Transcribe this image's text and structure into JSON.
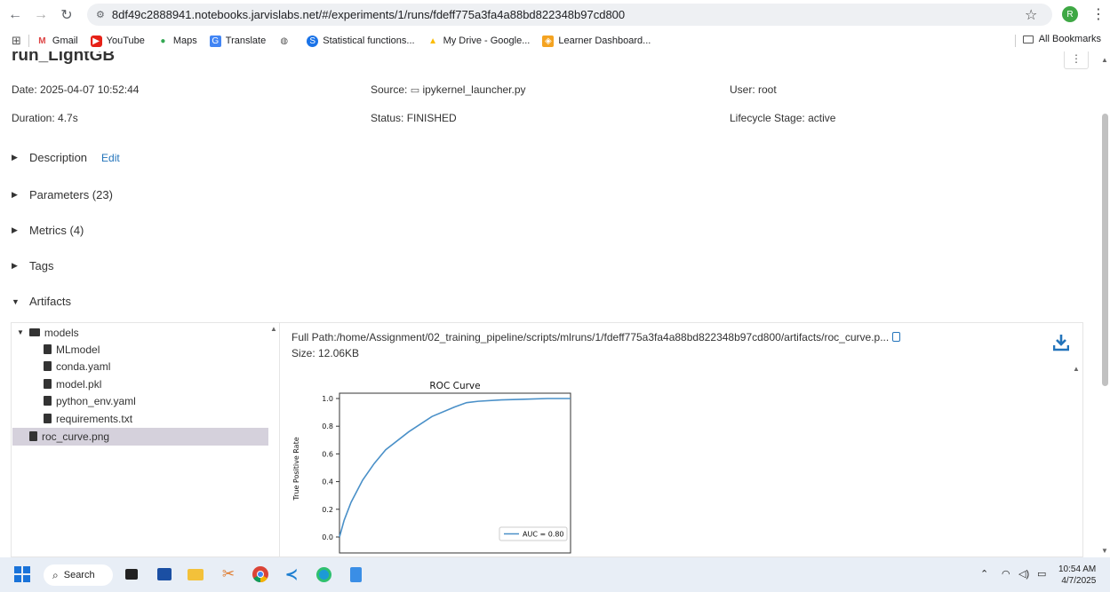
{
  "browser": {
    "url": "8df49c2888941.notebooks.jarvislabs.net/#/experiments/1/runs/fdeff775a3fa4a88bd822348b97cd800",
    "profile_initial": "R",
    "bookmarks": [
      "Gmail",
      "YouTube",
      "Maps",
      "Translate",
      "",
      "Statistical functions...",
      "My Drive - Google...",
      "Learner Dashboard..."
    ],
    "all_bookmarks": "All Bookmarks"
  },
  "run": {
    "title": "run_LightGB",
    "date_label": "Date:",
    "date_value": "2025-04-07 10:52:44",
    "source_label": "Source:",
    "source_value": "ipykernel_launcher.py",
    "user_label": "User:",
    "user_value": "root",
    "duration_label": "Duration:",
    "duration_value": "4.7s",
    "status_label": "Status:",
    "status_value": "FINISHED",
    "lifecycle_label": "Lifecycle Stage:",
    "lifecycle_value": "active"
  },
  "sections": {
    "description": "Description",
    "edit": "Edit",
    "parameters": "Parameters (23)",
    "metrics": "Metrics (4)",
    "tags": "Tags",
    "artifacts": "Artifacts"
  },
  "tree": {
    "models": "models",
    "mlmodel": "MLmodel",
    "conda": "conda.yaml",
    "model_pkl": "model.pkl",
    "python_env": "python_env.yaml",
    "requirements": "requirements.txt",
    "roc": "roc_curve.png"
  },
  "preview": {
    "full_path": "Full Path:/home/Assignment/02_training_pipeline/scripts/mlruns/1/fdeff775a3fa4a88bd822348b97cd800/artifacts/roc_curve.p...",
    "size": "Size: 12.06KB"
  },
  "chart_data": {
    "type": "line",
    "title": "ROC Curve",
    "ylabel": "True Positive Rate",
    "ylim": [
      0,
      1.0
    ],
    "xlim": [
      0,
      1.0
    ],
    "y_ticks": [
      "0.0",
      "0.2",
      "0.4",
      "0.6",
      "0.8",
      "1.0"
    ],
    "series": [
      {
        "name": "AUC = 0.80",
        "color": "#4a90c8",
        "x": [
          0.0,
          0.02,
          0.05,
          0.1,
          0.15,
          0.2,
          0.3,
          0.4,
          0.5,
          0.55,
          0.6,
          0.7,
          0.8,
          0.9,
          1.0
        ],
        "y": [
          0.0,
          0.12,
          0.25,
          0.41,
          0.53,
          0.63,
          0.76,
          0.87,
          0.94,
          0.97,
          0.98,
          0.99,
          0.995,
          1.0,
          1.0
        ]
      }
    ],
    "legend_position": "bottom-right",
    "grid": false
  },
  "taskbar": {
    "search": "Search",
    "time": "10:54 AM",
    "date": "4/7/2025"
  }
}
